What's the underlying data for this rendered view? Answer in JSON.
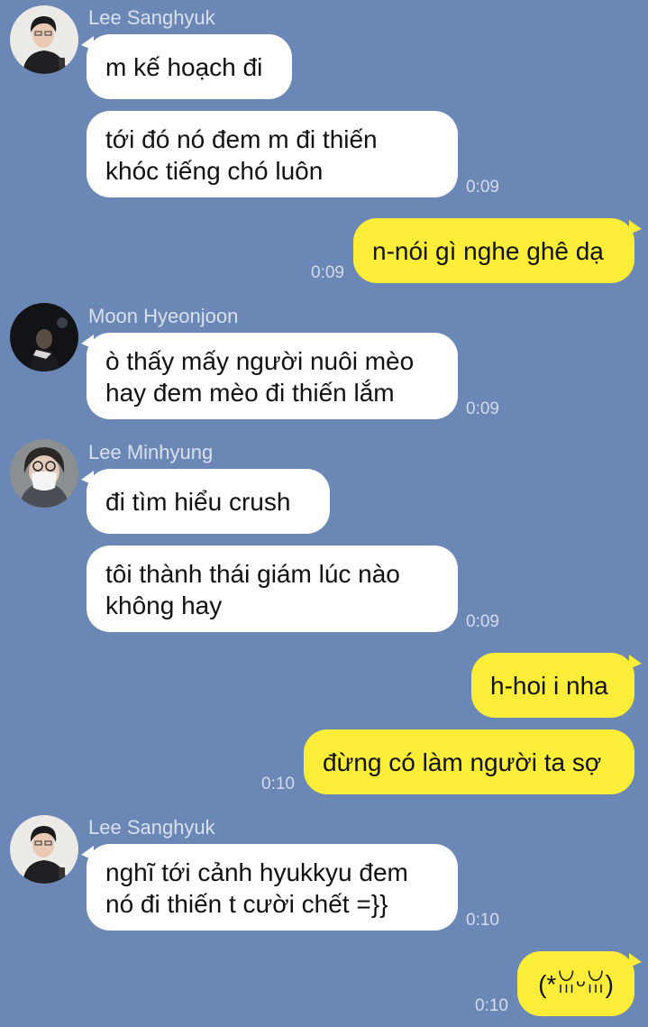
{
  "messages": [
    {
      "sender": "Lee Sanghyuk",
      "text": "m kế hoạch đi"
    },
    {
      "text_lines": [
        "tới đó nó đem m đi thiến",
        "khóc tiếng chó luôn"
      ],
      "time": "0:09"
    },
    {
      "text": "n-nói gì nghe ghê dạ",
      "time": "0:09"
    },
    {
      "sender": "Moon Hyeonjoon",
      "text_lines": [
        "ò thấy mấy người nuôi mèo",
        "hay đem mèo đi thiến lắm"
      ],
      "time": "0:09"
    },
    {
      "sender": "Lee Minhyung",
      "text": "đi tìm hiểu crush"
    },
    {
      "text_lines": [
        "tôi thành thái giám lúc nào",
        "không hay"
      ],
      "time": "0:09"
    },
    {
      "text": "h-hoi i nha"
    },
    {
      "text": "đừng có làm người ta sợ",
      "time": "0:10"
    },
    {
      "sender": "Lee Sanghyuk",
      "text_lines": [
        "nghĩ tới cảnh hyukkyu đem",
        "nó đi thiến t cười chết =}}"
      ],
      "time": "0:10"
    },
    {
      "text": "(*ꈍᵕꈍ)",
      "time": "0:10"
    }
  ],
  "colors": {
    "background": "#6b87b5",
    "incoming_bubble": "#ffffff",
    "outgoing_bubble": "#fbed38"
  }
}
